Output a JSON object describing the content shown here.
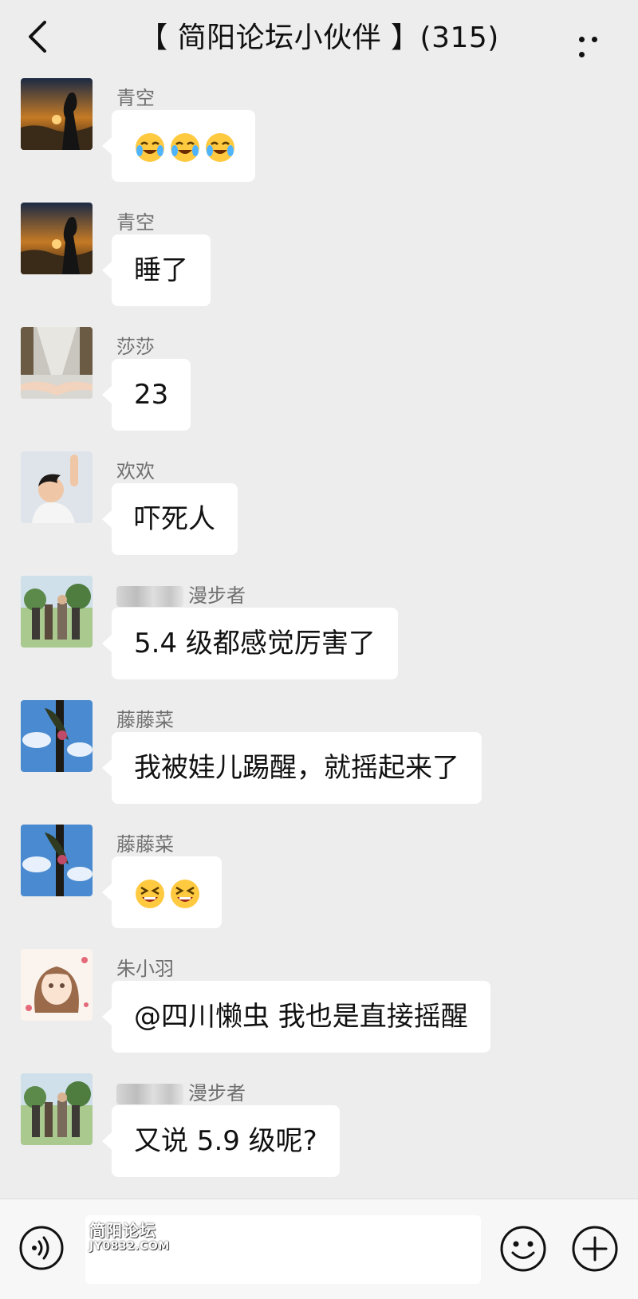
{
  "header": {
    "title": "【 简阳论坛小伙伴 】(315)",
    "back_icon": "chevron-left-icon",
    "more_icon": "more-dots-icon"
  },
  "messages": [
    {
      "sender": "青空",
      "avatar": "sunset-silhouette-avatar",
      "emoji_icon": "crying-laughing-emoji",
      "emoji_count": 3
    },
    {
      "sender": "青空",
      "avatar": "sunset-silhouette-avatar",
      "text": "睡了"
    },
    {
      "sender": "莎莎",
      "avatar": "holding-hands-avatar",
      "text": "23"
    },
    {
      "sender": "欢欢",
      "avatar": "boy-waving-avatar",
      "text": "吓死人"
    },
    {
      "sender": "漫步者",
      "avatar": "group-photo-avatar",
      "text": "5.4 级都感觉厉害了"
    },
    {
      "sender": "藤藤菜",
      "avatar": "tree-sky-avatar",
      "text": "我被娃儿踢醒，就摇起来了"
    },
    {
      "sender": "藤藤菜",
      "avatar": "tree-sky-avatar",
      "emoji_icon": "grinning-squint-emoji",
      "emoji_count": 2
    },
    {
      "sender": "朱小羽",
      "avatar": "anime-girl-avatar",
      "text": "@四川懒虫  我也是直接摇醒"
    },
    {
      "sender": "漫步者",
      "avatar": "group-photo-avatar",
      "text": "又说 5.9 级呢?"
    }
  ],
  "bottom_bar": {
    "voice_icon": "voice-icon",
    "input_value": "",
    "emoji_icon": "smiley-icon",
    "plus_icon": "plus-circle-icon",
    "watermark": {
      "line1": "简阳论坛",
      "line2": "JY0832.COM"
    }
  },
  "colors": {
    "background": "#ededed",
    "bubble": "#ffffff",
    "name_text": "#707070",
    "bottom_bar": "#f7f7f7"
  }
}
